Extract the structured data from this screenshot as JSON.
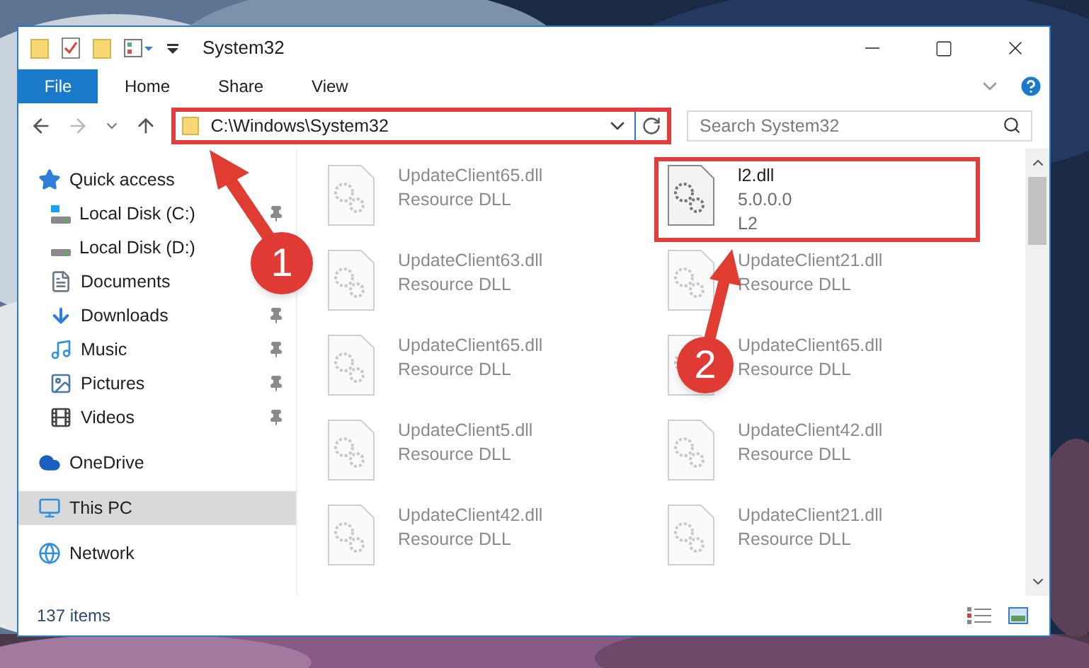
{
  "window": {
    "title": "System32"
  },
  "ribbon": {
    "file_tab": "File",
    "tabs": [
      {
        "label": "Home",
        "selected": false
      },
      {
        "label": "Share",
        "selected": false
      },
      {
        "label": "View",
        "selected": false
      }
    ]
  },
  "address": {
    "path": "C:\\Windows\\System32",
    "highlighted": true
  },
  "search": {
    "placeholder": "Search System32"
  },
  "sidebar": {
    "items": [
      {
        "label": "Quick access",
        "kind": "star",
        "selected": false,
        "children": [
          {
            "label": "Local Disk (C:)",
            "kind": "system-drive",
            "pinned": true,
            "selected": false
          },
          {
            "label": "Local Disk (D:)",
            "kind": "drive",
            "pinned": false,
            "selected": false
          },
          {
            "label": "Documents",
            "kind": "documents",
            "pinned": false,
            "selected": false
          },
          {
            "label": "Downloads",
            "kind": "downloads",
            "pinned": true,
            "selected": false
          },
          {
            "label": "Music",
            "kind": "music",
            "pinned": true,
            "selected": false
          },
          {
            "label": "Pictures",
            "kind": "pictures",
            "pinned": true,
            "selected": false
          },
          {
            "label": "Videos",
            "kind": "videos",
            "pinned": true,
            "selected": false
          }
        ]
      },
      {
        "label": "OneDrive",
        "kind": "cloud",
        "selected": false
      },
      {
        "label": "This PC",
        "kind": "pc",
        "selected": true
      },
      {
        "label": "Network",
        "kind": "network",
        "selected": false
      }
    ]
  },
  "files": [
    {
      "name": "UpdateClient65.dll",
      "detail": "Resource DLL",
      "blurred": true,
      "highlighted": false
    },
    {
      "name": "l2.dll",
      "version": "5.0.0.0",
      "company": "L2",
      "blurred": false,
      "highlighted": true
    },
    {
      "name": "UpdateClient63.dll",
      "detail": "Resource DLL",
      "blurred": true,
      "highlighted": false
    },
    {
      "name": "UpdateClient21.dll",
      "detail": "Resource DLL",
      "blurred": true,
      "highlighted": false
    },
    {
      "name": "UpdateClient65.dll",
      "detail": "Resource DLL",
      "blurred": true,
      "highlighted": false
    },
    {
      "name": "UpdateClient65.dll",
      "detail": "Resource DLL",
      "blurred": true,
      "highlighted": false
    },
    {
      "name": "UpdateClient5.dll",
      "detail": "Resource DLL",
      "blurred": true,
      "highlighted": false
    },
    {
      "name": "UpdateClient42.dll",
      "detail": "Resource DLL",
      "blurred": true,
      "highlighted": false
    },
    {
      "name": "UpdateClient42.dll",
      "detail": "Resource DLL",
      "blurred": true,
      "highlighted": false
    },
    {
      "name": "UpdateClient21.dll",
      "detail": "Resource DLL",
      "blurred": true,
      "highlighted": false
    }
  ],
  "status_bar": {
    "item_count": "137 items"
  },
  "annotations": [
    {
      "number": "1"
    },
    {
      "number": "2"
    }
  ]
}
